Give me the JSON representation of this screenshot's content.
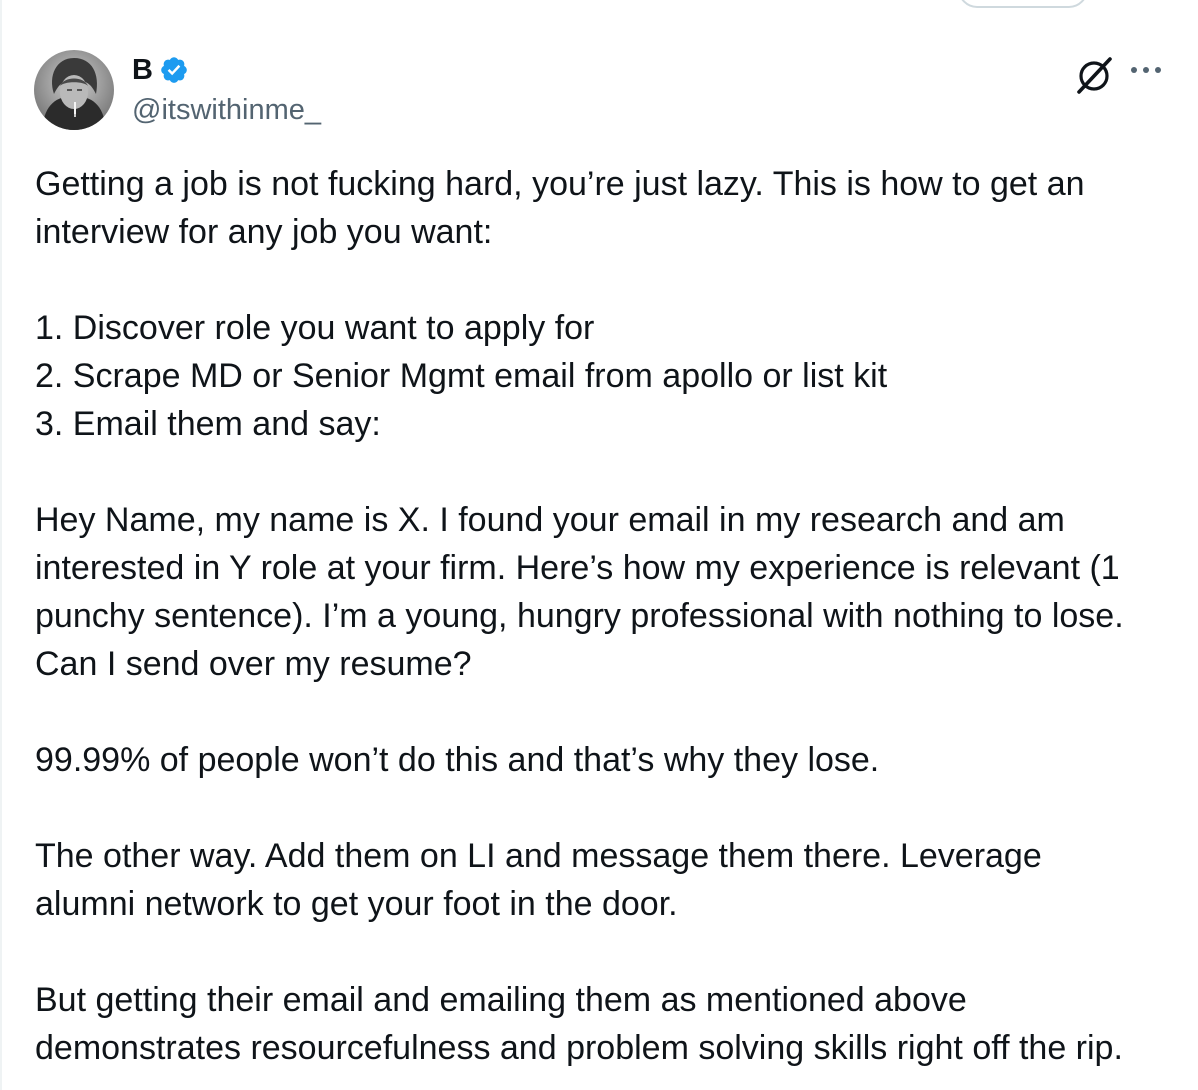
{
  "author": {
    "display_name": "B",
    "handle": "@itswithinme_",
    "verified": true,
    "verified_color": "#1d9bf0"
  },
  "icons": {
    "avatar": "avatar-photo",
    "verified": "verified-badge-icon",
    "grok": "grok-icon",
    "more": "more-options-icon"
  },
  "tweet": {
    "paragraphs": [
      {
        "lines": [
          "Getting a job is not fucking hard, you’re just lazy. This is how to get an",
          "interview for any job you want:"
        ]
      },
      {
        "lines": [
          "1. Discover role you want to apply for",
          "2. Scrape MD or Senior Mgmt email from apollo or list kit",
          "3. Email them and say:"
        ]
      },
      {
        "lines": [
          "Hey Name, my name is X. I found your email in my research and am",
          "interested in Y role at your firm. Here’s how my experience is relevant (1",
          "punchy sentence). I’m a young, hungry professional with nothing to lose.",
          "Can I send over my resume?"
        ]
      },
      {
        "lines": [
          "99.99% of people won’t do this and that’s why they lose."
        ]
      },
      {
        "lines": [
          "The other way. Add them on LI and message them there. Leverage",
          "alumni network to get your foot in the door."
        ]
      },
      {
        "lines": [
          "But getting their email and emailing them as mentioned above",
          "demonstrates resourcefulness and problem solving skills right off the rip."
        ]
      }
    ]
  }
}
